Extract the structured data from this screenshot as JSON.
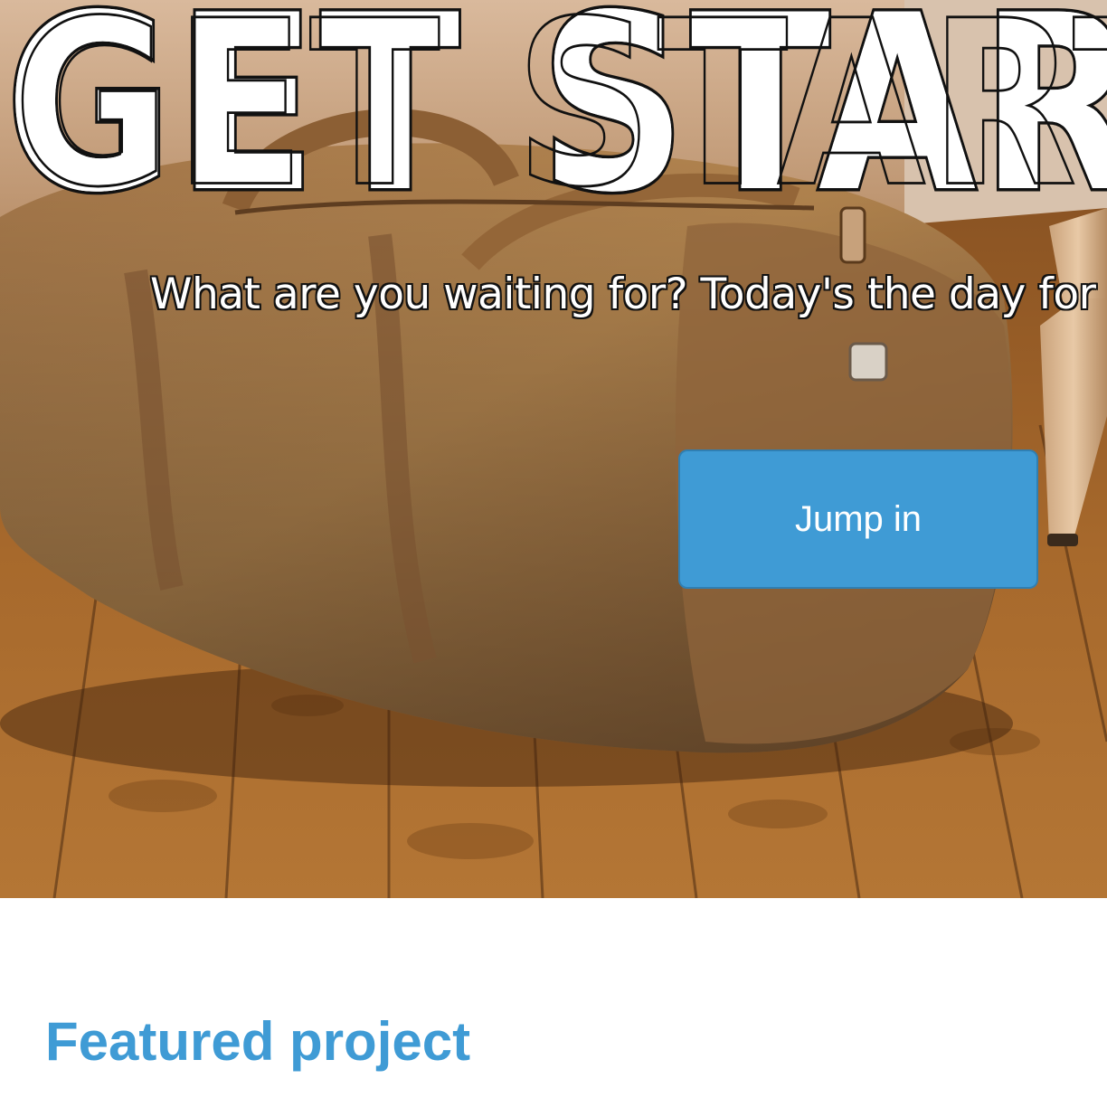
{
  "hero": {
    "headline": "GET STARTED",
    "tagline": "What are you waiting for? Today's the day for",
    "cta_label": "Jump in",
    "background": "duffel-bag-on-wooden-floor-photo"
  },
  "featured": {
    "title": "Featured project"
  },
  "colors": {
    "accent": "#3f9bd5",
    "button_border": "#2f7fb3",
    "headline_fill": "#ffffff",
    "headline_outline": "#111111"
  }
}
